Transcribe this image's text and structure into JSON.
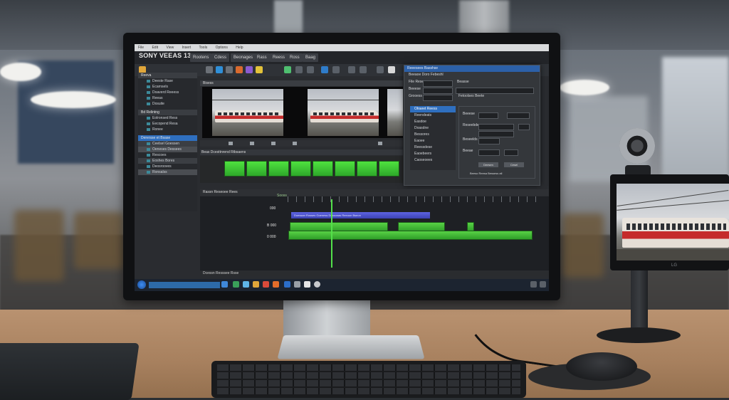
{
  "scene": "photo",
  "app": {
    "title": "SONY VEEAS 13",
    "menubar": [
      "File",
      "Edit",
      "View",
      "Insert",
      "Tools",
      "Options",
      "Help"
    ],
    "menu_buttons": [
      "Rootens",
      "Cdess",
      "Beonages",
      "Rass",
      "Reess",
      "Ross",
      "Baag"
    ]
  },
  "left_panel": {
    "section1_header": "Reeva",
    "section1_items": [
      "Deeste Rase",
      "Ecarnsels",
      "Doaverd Reeess",
      "Reeas",
      "Dosuite"
    ],
    "section2_header": "Bd Relintng",
    "section2_items": [
      "Eolronsed Ress",
      "Eecopend Resa",
      "Ronee"
    ],
    "section3_header": "Derersse et Bsase",
    "section3_items": [
      "Ceelsel Goessen",
      "Oeneses Dessees",
      "Rescoes",
      "Eoshes Bores",
      "Deosrooves",
      "Ronsalss"
    ]
  },
  "preview": {
    "header": "Bisess",
    "track_header": "Beas Dcesttnrend Rtbsaens",
    "timeline_header": "Rassn Reseoee Rees",
    "status": "Dcessn Resssee Rsse"
  },
  "dialog": {
    "title": "Reeesees Basshse",
    "subtitle": "Beeaoe Doro Febeshl",
    "fields": [
      "File Rese",
      "Beasse",
      "Beeese",
      "Grooess"
    ],
    "checkbox": "Fetoolses Beete",
    "list_items": [
      "Olraeet Reess",
      "Reendeats",
      "Easdoe",
      "Doasdne",
      "Bessores",
      "Eaoee",
      "Reessdese",
      "Eaoebeers",
      "Caoseoees"
    ],
    "options": [
      "Beeese",
      "Reseebdes",
      "Beseelds",
      "Beeae"
    ],
    "buttons": [
      "Deesen",
      "Cesel",
      "Ease"
    ],
    "footer": "Beeso Reesa Bessess all"
  },
  "timeline": {
    "track_labels": [
      "000",
      "B 000",
      "0 000"
    ],
    "ruler_label": "Sooss",
    "clip_label": "Doessan Rosses Goeness Dessonas Reeoon Bseon"
  },
  "right_display": {
    "logo": "LG"
  },
  "colors": {
    "accent_blue": "#2c60a8",
    "clip_green": "#4fe23f",
    "clip_blue": "#5d63e0",
    "train_red": "#c52b2b"
  }
}
